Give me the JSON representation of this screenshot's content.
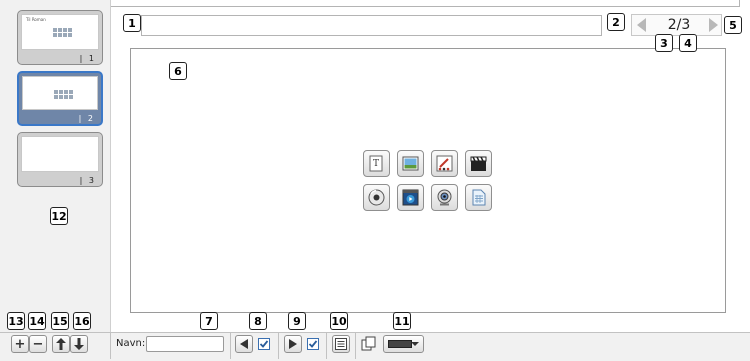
{
  "sidebar": {
    "slides": [
      {
        "number": "1",
        "mini_title": "Til Roman"
      },
      {
        "number": "2"
      },
      {
        "number": "3"
      }
    ]
  },
  "callouts": [
    "1",
    "2",
    "3",
    "4",
    "5",
    "6",
    "7",
    "8",
    "9",
    "10",
    "11",
    "12",
    "13",
    "14",
    "15",
    "16"
  ],
  "header": {
    "title_value": "",
    "page_indicator": "2/3"
  },
  "content_icons": [
    "text-icon",
    "image-icon",
    "drawing-icon",
    "video-clapper-icon",
    "audio-icon",
    "media-player-icon",
    "webcam-icon",
    "document-icon"
  ],
  "bottombar": {
    "add_label": "+",
    "remove_label": "−",
    "navn_label": "Navn:",
    "navn_value": ""
  },
  "colors": {
    "selected_border": "#3a78c8",
    "checkbox": "#3a6fb0"
  }
}
